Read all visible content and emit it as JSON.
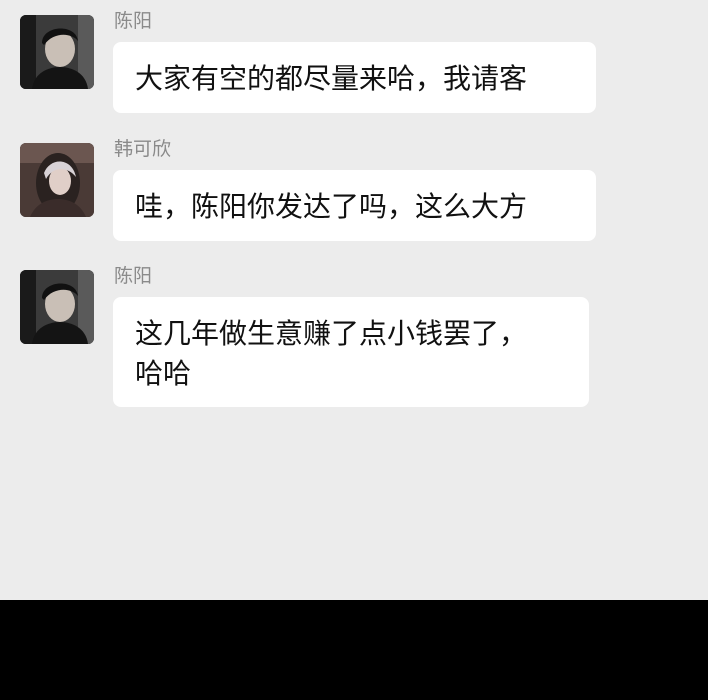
{
  "colors": {
    "chat_background": "#ececec",
    "bubble_background": "#ffffff",
    "sender_name": "#8a8a8a",
    "message_text": "#111111",
    "bottom_bar": "#000000"
  },
  "messages": [
    {
      "sender": "陈阳",
      "avatar_icon": "male-avatar-photo",
      "lines": [
        "大家有空的都尽量来哈，我请客"
      ]
    },
    {
      "sender": "韩可欣",
      "avatar_icon": "female-avatar-photo",
      "lines": [
        "哇，陈阳你发达了吗，这么大方"
      ]
    },
    {
      "sender": "陈阳",
      "avatar_icon": "male-avatar-photo",
      "lines": [
        "这几年做生意赚了点小钱罢了，",
        "哈哈"
      ]
    }
  ]
}
